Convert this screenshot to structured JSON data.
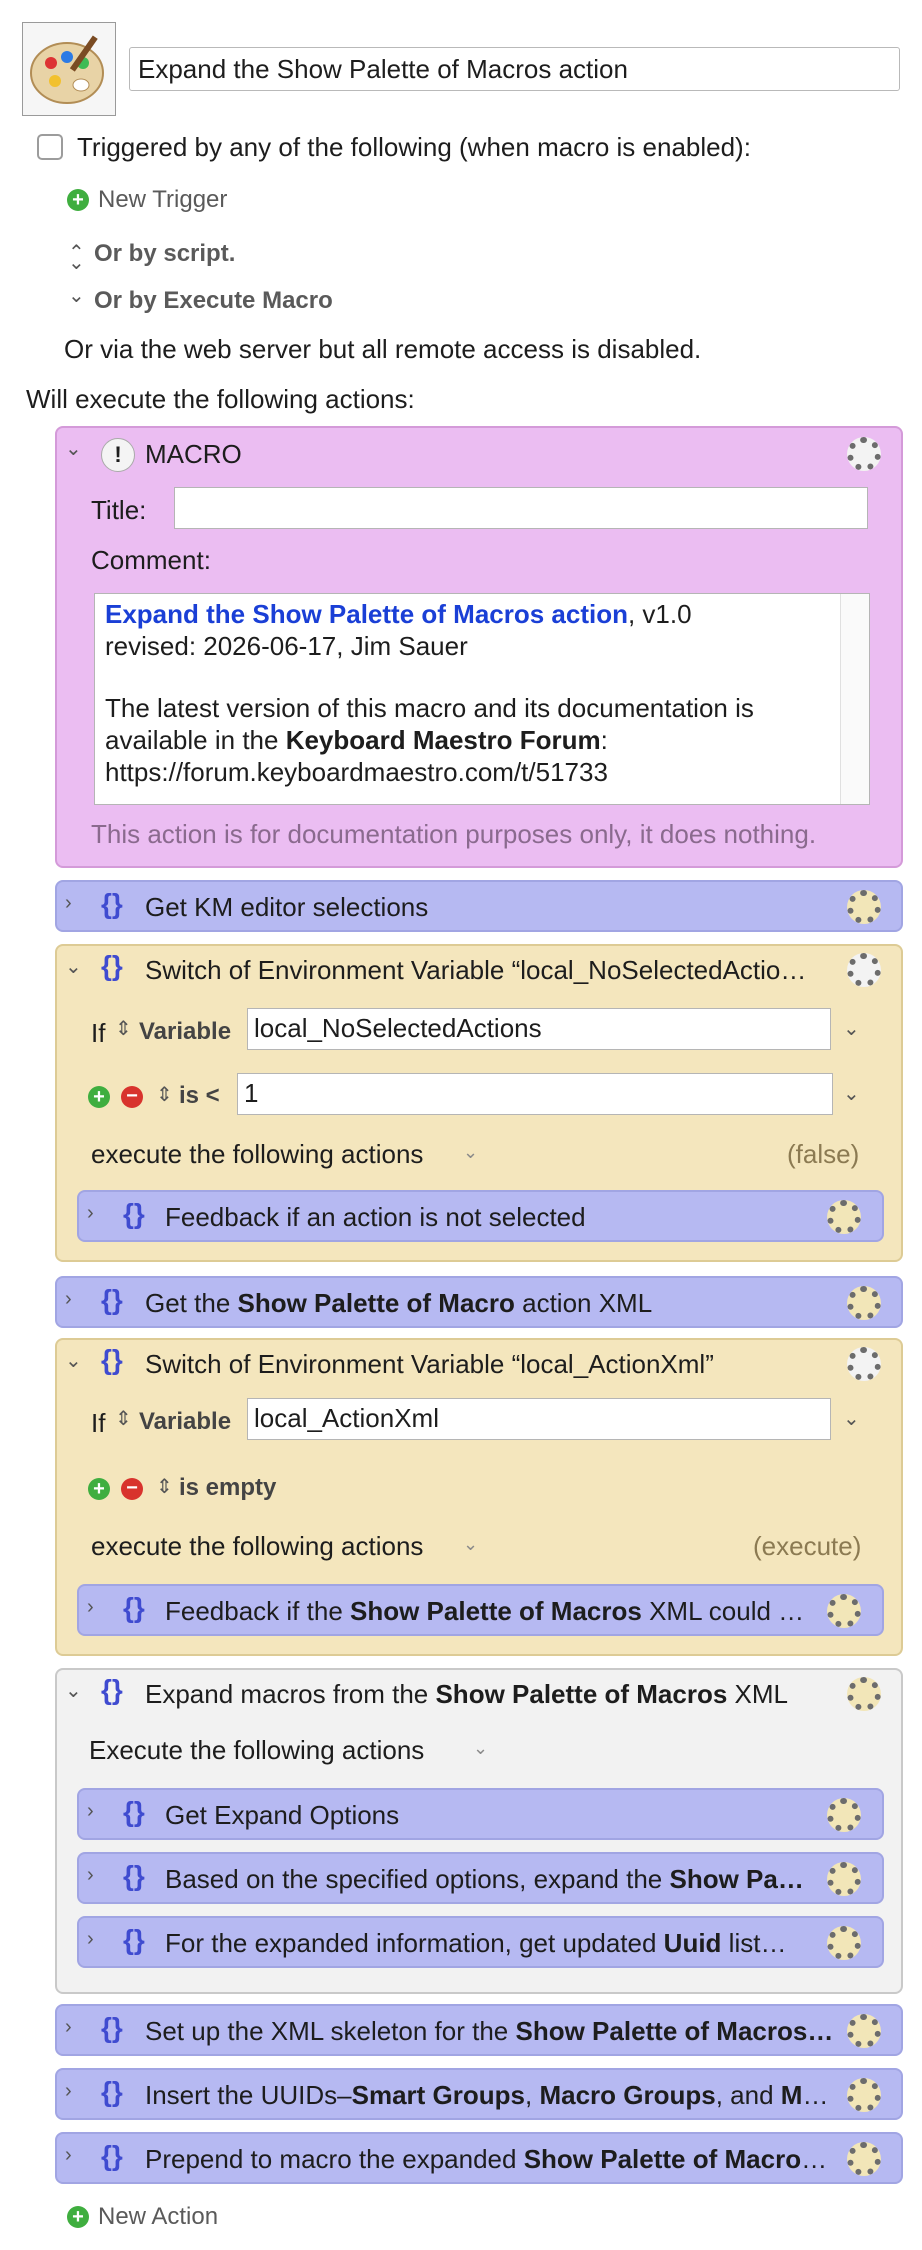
{
  "macro": {
    "title": "Expand the Show Palette of Macros action"
  },
  "triggers": {
    "triggered_by_label": "Triggered by any of the following (when macro is enabled):",
    "new_trigger_label": "New Trigger",
    "or_by_script_label": "Or by script.",
    "or_by_execute_label": "Or by Execute Macro",
    "web_server_text": "Or via the web server but all remote access is disabled."
  },
  "actions": {
    "header": "Will execute the following actions:",
    "comment_block": {
      "name": "MACRO",
      "title_label": "Title:",
      "title_value": "",
      "comment_label": "Comment:",
      "comment_link": "Expand the Show Palette of Macros action",
      "comment_version": ", v1.0",
      "comment_revised": "revised: 2026-06-17, Jim Sauer",
      "comment_para1": "The latest version of this macro and its documentation is",
      "comment_para2_pre": "available in the ",
      "comment_para2_bold": "Keyboard Maestro Forum",
      "comment_para2_post": ":",
      "comment_url": "https://forum.keyboardmaestro.com/t/51733",
      "footer": "This action is for documentation purposes only, it does nothing."
    },
    "group1": "Get KM editor selections",
    "switch1": {
      "title": "Switch of Environment Variable “local_NoSelectedActio…",
      "if_label": "If",
      "variable_label": "Variable",
      "variable_value": "local_NoSelectedActions",
      "condition_label": "is <",
      "condition_value": "1",
      "execute_label": "execute the following actions",
      "state": "(false)",
      "child": "Feedback if an action is not selected"
    },
    "group2": {
      "pre": "Get the ",
      "bold": "Show Palette of Macro",
      "post": " action XML"
    },
    "switch2": {
      "title": "Switch of Environment Variable “local_ActionXml”",
      "if_label": "If",
      "variable_label": "Variable",
      "variable_value": "local_ActionXml",
      "condition_label": "is empty",
      "execute_label": "execute the following actions",
      "state": "(execute)",
      "child_pre": "Feedback if the ",
      "child_bold": "Show Palette of Macros",
      "child_post": " XML could n…"
    },
    "expand_group": {
      "pre": "Expand macros from the ",
      "bold": "Show Palette of Macros",
      "post": " XML",
      "execute_label": "Execute the following actions",
      "child1": "Get Expand Options",
      "child2_pre": "Based on the specified options, expand the ",
      "child2_bold": "Show Pa…",
      "child3_pre": "For the expanded information, get updated ",
      "child3_bold": "Uuid",
      "child3_post": " list…"
    },
    "group3": {
      "pre": "Set up the XML skeleton for the ",
      "bold": "Show Palette of Macros…"
    },
    "group4": {
      "pre": "Insert the UUIDs–",
      "bold1": "Smart Groups",
      "mid1": ", ",
      "bold2": "Macro Groups",
      "mid2": ", and ",
      "bold3": "Macr…"
    },
    "group5": {
      "pre": "Prepend to macro the expanded ",
      "bold": "Show Palette of Macros…"
    },
    "new_action_label": "New Action"
  },
  "icons": {
    "app_icon": "palette-icon",
    "gear": "gear-icon",
    "clock_gear": "clock-gear-icon",
    "braces": "braces-icon",
    "plus": "plus-icon",
    "minus": "minus-icon",
    "comment": "exclamation-icon"
  },
  "colors": {
    "comment_block_bg": "#ebbdf2",
    "group_bg": "#b6b9f2",
    "switch_bg": "#f4e6bd",
    "link_color": "#1a3fd6",
    "add_green": "#3fae3f",
    "remove_red": "#d8332d"
  }
}
